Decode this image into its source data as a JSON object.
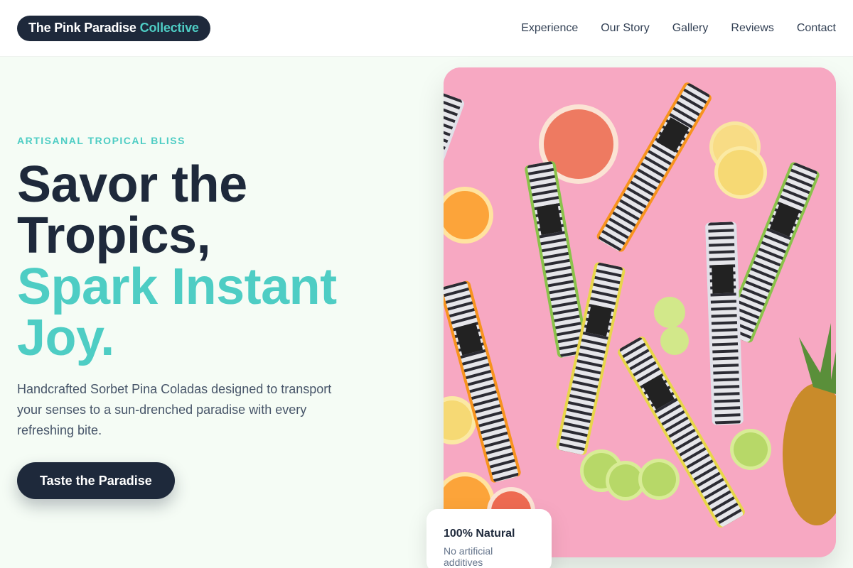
{
  "brand": {
    "name": "The Pink Paradise",
    "accent": "Collective"
  },
  "nav": [
    "Experience",
    "Our Story",
    "Gallery",
    "Reviews",
    "Contact"
  ],
  "hero": {
    "eyebrow": "ARTISANAL TROPICAL BLISS",
    "headline_dark_1": "Savor the",
    "headline_dark_2": "Tropics,",
    "headline_teal_1": "Spark Instant",
    "headline_teal_2": "Joy.",
    "description": "Handcrafted Sorbet Pina Coladas designed to transport your senses to a sun-drenched paradise with every refreshing bite.",
    "cta": "Taste the Paradise"
  },
  "badge": {
    "title": "100% Natural",
    "subtitle": "No artificial additives"
  },
  "colors": {
    "dark": "#1e293b",
    "accent": "#4ecdc4",
    "background": "#f5fcf5",
    "photo_pink": "#f7a8c2"
  },
  "icons": {
    "photo": "popsicle-product-photo"
  }
}
